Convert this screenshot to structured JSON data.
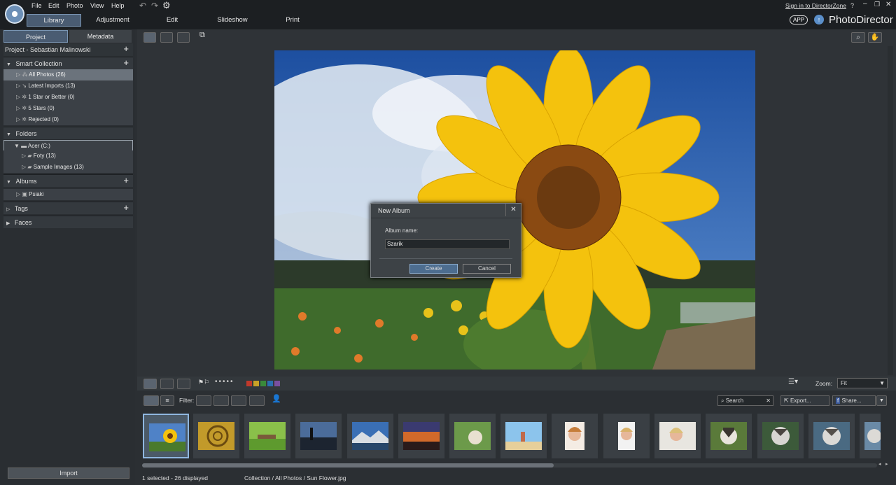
{
  "menus": [
    "File",
    "Edit",
    "Photo",
    "View",
    "Help"
  ],
  "modules": [
    "Library",
    "Adjustment",
    "Edit",
    "Slideshow",
    "Print"
  ],
  "signin": "Sign in to DirectorZone",
  "help": "?",
  "app_badge": "APP",
  "brand": "PhotoDirector",
  "panel_tabs": [
    "Project",
    "Metadata"
  ],
  "project_title": "Project - Sebastian Malinowski",
  "smart_collection": {
    "label": "Smart Collection",
    "items": [
      "All Photos (26)",
      "Latest Imports (13)",
      "1 Star or Better (0)",
      "5 Stars (0)",
      "Rejected (0)"
    ]
  },
  "folders": {
    "label": "Folders",
    "drive": "Acer (C:)",
    "items": [
      "Foty (13)",
      "Sample Images (13)"
    ]
  },
  "albums": {
    "label": "Albums",
    "items": [
      "Psiaki"
    ]
  },
  "tags": "Tags",
  "faces": "Faces",
  "import_label": "Import",
  "dialog": {
    "title": "New Album",
    "label": "Album name:",
    "value": "Szarik",
    "create": "Create",
    "cancel": "Cancel"
  },
  "toolbar": {
    "filter": "Filter:",
    "zoom_label": "Zoom:",
    "zoom_value": "Fit",
    "search_placeholder": "Search",
    "export": "Export...",
    "share": "Share..."
  },
  "status": {
    "selection": "1 selected - 26 displayed",
    "path": "Collection / All Photos / Sun Flower.jpg"
  },
  "color_labels": [
    "#c0392b",
    "#c9a227",
    "#3a8a3a",
    "#2a6fb0",
    "#7a4fa0"
  ],
  "thumbnails": [
    "sunflower",
    "shell",
    "park-bench",
    "lake-silhouette",
    "mountain-lake",
    "sunset",
    "cat",
    "beach",
    "woman-smiling",
    "woman-portrait",
    "woman-blonde",
    "husky",
    "husky-2",
    "husky-3",
    "husky-4"
  ]
}
